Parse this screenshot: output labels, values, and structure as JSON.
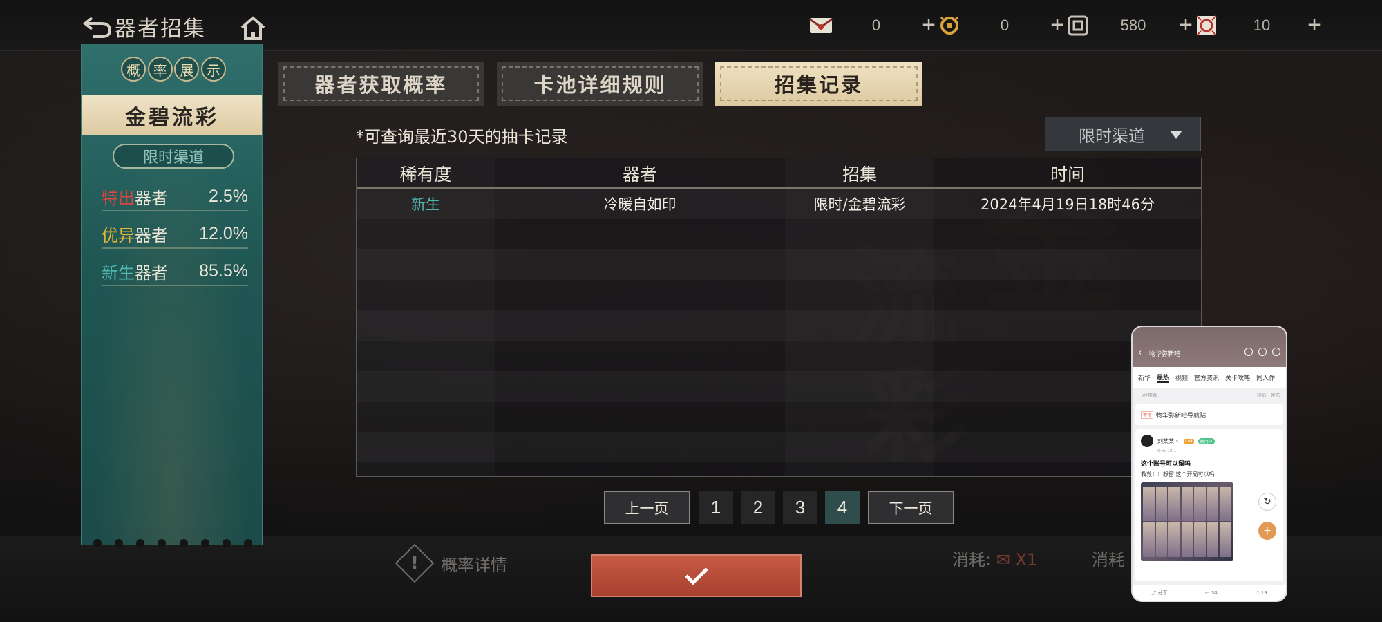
{
  "topbar": {
    "title": "器者招集",
    "resources": [
      {
        "icon": "envelope-ticket-icon",
        "value": "0"
      },
      {
        "icon": "gold-medal-icon",
        "value": "0"
      },
      {
        "icon": "jade-coin-icon",
        "value": "580"
      },
      {
        "icon": "seal-ticket-icon",
        "value": "10"
      }
    ]
  },
  "left_panel": {
    "header_chars": [
      "概",
      "率",
      "展",
      "示"
    ],
    "banner_name": "金碧流彩",
    "channel": "限时渠道",
    "rates": [
      {
        "rarity": "特出",
        "role": "器者",
        "percent": "2.5%",
        "color": "#e0443a"
      },
      {
        "rarity": "优异",
        "role": "器者",
        "percent": "12.0%",
        "color": "#e2b437"
      },
      {
        "rarity": "新生",
        "role": "器者",
        "percent": "85.5%",
        "color": "#4fb6b0"
      }
    ]
  },
  "tabs": [
    {
      "label": "器者获取概率",
      "active": false
    },
    {
      "label": "卡池详细规则",
      "active": false
    },
    {
      "label": "招集记录",
      "active": true
    }
  ],
  "records": {
    "note": "*可查询最近30天的抽卡记录",
    "filter_selected": "限时渠道",
    "columns": [
      "稀有度",
      "器者",
      "招集",
      "时间"
    ],
    "rows": [
      {
        "rarity": "新生",
        "rarity_color": "#4fb6b0",
        "character": "冷暖自如印",
        "pool": "限时/金碧流彩",
        "time": "2024年4月19日18时46分"
      }
    ]
  },
  "pagination": {
    "prev": "上一页",
    "next": "下一页",
    "pages": [
      "1",
      "2",
      "3",
      "4"
    ],
    "current": "4"
  },
  "bottom": {
    "probability_details": "概率详情",
    "cost_label": "消耗:",
    "cost_multiplier": "X1",
    "cost_label_2": "消耗"
  },
  "phone_overlay": {
    "forum_title": "物华弥新吧",
    "tabs": [
      "新华",
      "最热",
      "视频",
      "官方资讯",
      "关卡攻略",
      "同人作"
    ],
    "active_tab": "最热",
    "sort_left": "已经推荐",
    "sort_right_1": "顶贴",
    "sort_right_2": "发布",
    "pinned_tag": "置顶",
    "pinned_text": "物华弥新吧导航贴",
    "post_user": "刘某某丶",
    "post_level": "Lv4",
    "post_badge": "新用户",
    "post_time": "昨天 18:1",
    "post_title": "这个账号可以留吗",
    "post_body": "救救！！想留 这个开局可以吗",
    "footer": [
      "分享",
      "34",
      "19"
    ]
  }
}
